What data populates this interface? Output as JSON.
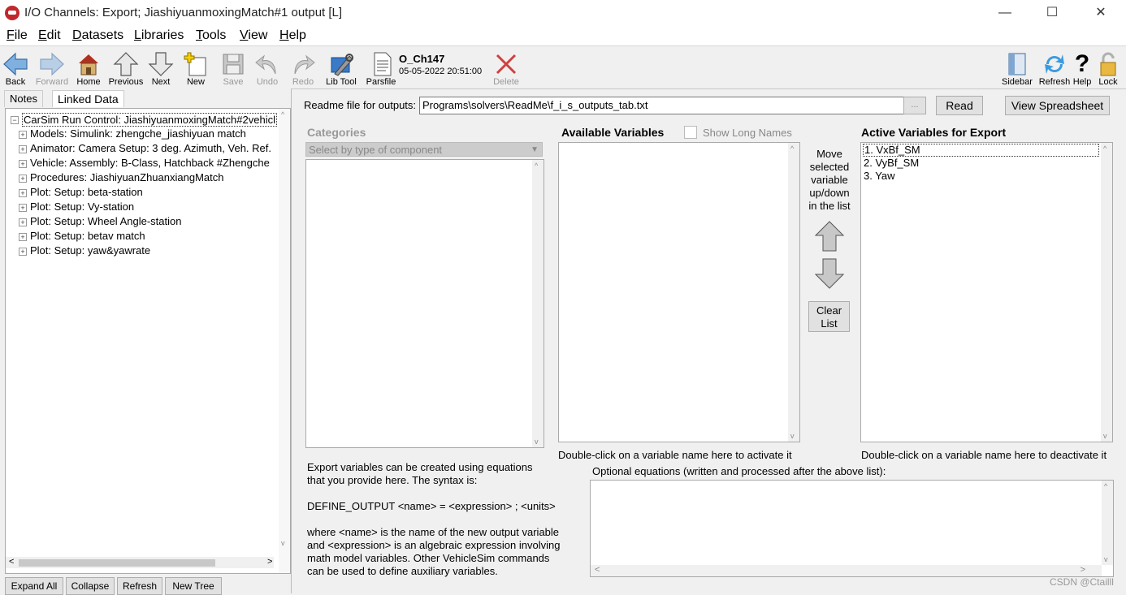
{
  "window": {
    "title": "I/O Channels: Export;  JiashiyuanmoxingMatch#1 output [L]",
    "minimize": "—",
    "maximize": "☐",
    "close": "✕"
  },
  "menu": [
    "File",
    "Edit",
    "Datasets",
    "Libraries",
    "Tools",
    "View",
    "Help"
  ],
  "toolbar": {
    "back": "Back",
    "forward": "Forward",
    "home": "Home",
    "previous": "Previous",
    "next": "Next",
    "new": "New",
    "save": "Save",
    "undo": "Undo",
    "redo": "Redo",
    "libtool": "Lib Tool",
    "parsfile": "Parsfile",
    "dataset_name": "O_Ch147",
    "dataset_date": "05-05-2022 20:51:00",
    "delete": "Delete",
    "sidebar": "Sidebar",
    "refresh": "Refresh",
    "help": "Help",
    "lock": "Lock"
  },
  "left": {
    "tabs": [
      "Notes",
      "Linked Data"
    ],
    "tree": [
      "CarSim Run Control: JiashiyuanmoxingMatch#2vehicl",
      "Models: Simulink: zhengche_jiashiyuan match",
      "Animator: Camera Setup: 3 deg. Azimuth, Veh. Ref.",
      "Vehicle: Assembly: B-Class, Hatchback #Zhengche",
      "Procedures: JiashiyuanZhuanxiangMatch",
      "Plot: Setup: beta-station",
      "Plot: Setup: Vy-station",
      "Plot: Setup: Wheel Angle-station",
      "Plot: Setup: betav match",
      "Plot: Setup: yaw&yawrate"
    ],
    "buttons": [
      "Expand All",
      "Collapse",
      "Refresh",
      "New Tree"
    ]
  },
  "readme": {
    "label": "Readme file for outputs:",
    "value": "Programs\\solvers\\ReadMe\\f_i_s_outputs_tab.txt",
    "browse": "...",
    "read": "Read",
    "view_spreadsheet": "View Spreadsheet"
  },
  "categories": {
    "title": "Categories",
    "select": "Select by type of component"
  },
  "available": {
    "title": "Available Variables",
    "show_long": "Show Long Names",
    "hint": "Double-click on a variable name here to activate it"
  },
  "move": {
    "text": [
      "Move",
      "selected",
      "variable",
      "up/down",
      "in the list"
    ],
    "clear": [
      "Clear",
      "List"
    ]
  },
  "active": {
    "title": "Active Variables for Export",
    "items": [
      "1. VxBf_SM",
      "2. VyBf_SM",
      "3. Yaw"
    ],
    "hint": "Double-click on a variable name here to deactivate it"
  },
  "help_text": [
    "Export variables can be created using equations",
    "that you provide here. The syntax is:",
    "",
    "DEFINE_OUTPUT <name> = <expression> ; <units>",
    "",
    "where <name> is the name of the new output variable",
    "and <expression> is an algebraic expression involving",
    "math model variables. Other VehicleSim commands",
    "can be used to define auxiliary variables."
  ],
  "equations_label": "Optional equations (written and processed after the above list):",
  "watermark": "CSDN @Ctailll"
}
